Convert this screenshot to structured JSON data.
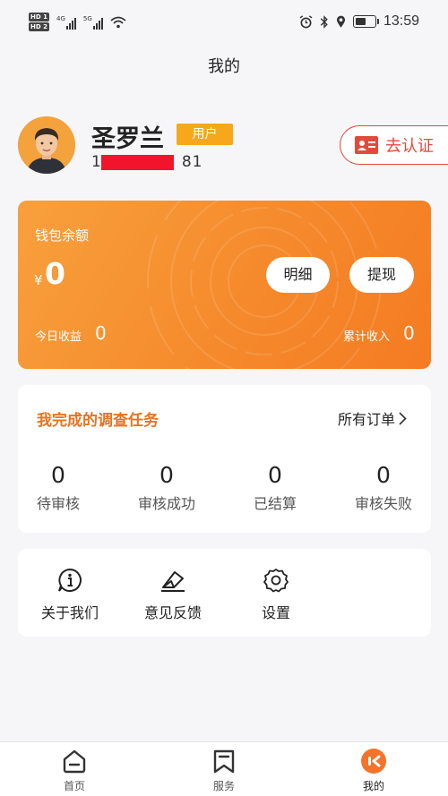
{
  "status_bar": {
    "hd_labels": [
      "HD 1",
      "HD 2"
    ],
    "net_labels": [
      "4G",
      "5G"
    ],
    "time": "13:59"
  },
  "header": {
    "title": "我的"
  },
  "profile": {
    "name": "圣罗兰",
    "badge": "用户",
    "phone_prefix": "1",
    "phone_suffix": "81",
    "verify_label": "去认证"
  },
  "wallet": {
    "balance_label": "钱包余额",
    "currency": "¥",
    "balance": "0",
    "detail_label": "明细",
    "withdraw_label": "提现",
    "today_label": "今日收益",
    "today_value": "0",
    "total_label": "累计收入",
    "total_value": "0"
  },
  "tasks": {
    "title": "我完成的调查任务",
    "all_orders_label": "所有订单",
    "stats": [
      {
        "value": "0",
        "label": "待审核"
      },
      {
        "value": "0",
        "label": "审核成功"
      },
      {
        "value": "0",
        "label": "已结算"
      },
      {
        "value": "0",
        "label": "审核失败"
      }
    ]
  },
  "tools": [
    {
      "label": "关于我们",
      "icon": "info-icon"
    },
    {
      "label": "意见反馈",
      "icon": "feedback-icon"
    },
    {
      "label": "设置",
      "icon": "gear-icon"
    }
  ],
  "tabbar": [
    {
      "label": "首页",
      "icon": "home-icon"
    },
    {
      "label": "服务",
      "icon": "bookmark-icon"
    },
    {
      "label": "我的",
      "icon": "profile-icon",
      "active": true
    }
  ],
  "colors": {
    "accent_orange": "#f58a2c",
    "task_title": "#e8731f",
    "verify_red": "#e24a3b",
    "badge": "#f6a81a",
    "redaction": "#f2142b"
  }
}
